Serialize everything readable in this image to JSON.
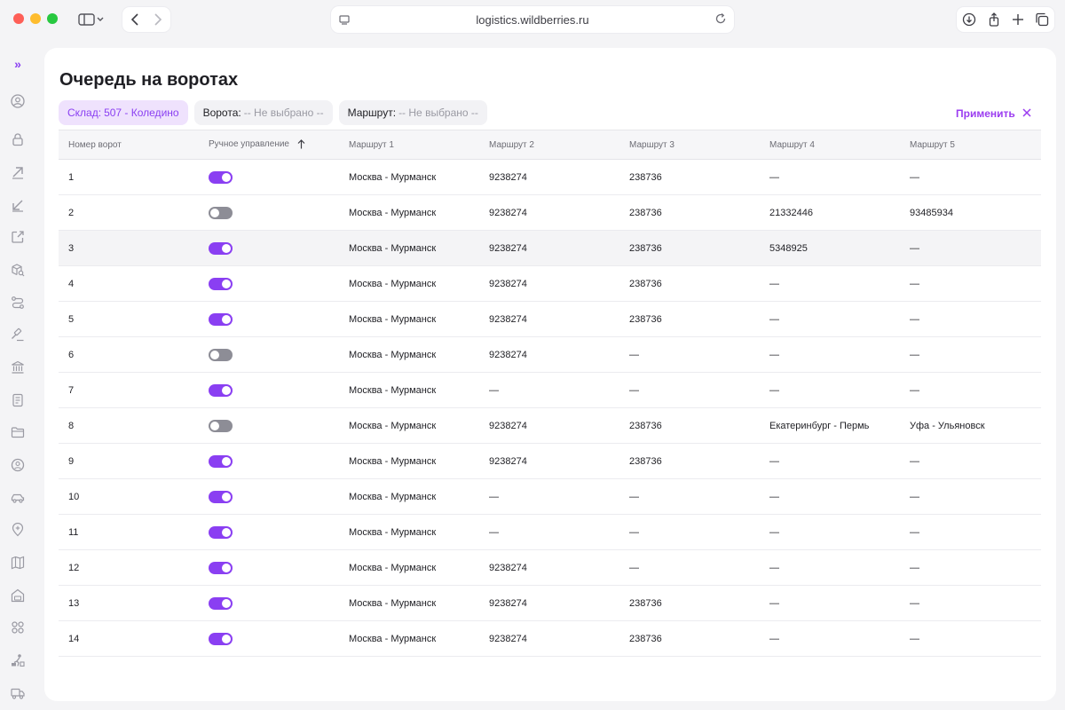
{
  "browser": {
    "url": "logistics.wildberries.ru"
  },
  "rail": {
    "items": [
      "expand-icon",
      "user-circle-icon",
      "lock-icon",
      "arrow-up-right-icon",
      "arrow-down-left-icon",
      "external-link-icon",
      "package-search-icon",
      "route-icon",
      "gavel-icon",
      "bank-icon",
      "document-icon",
      "folder-icon",
      "face-icon",
      "car-icon",
      "location-pin-icon",
      "map-icon",
      "warehouse-icon",
      "grid-icon",
      "worker-icon",
      "truck-icon"
    ]
  },
  "page": {
    "title": "Очередь на воротах"
  },
  "filters": {
    "warehouse": {
      "label": "Склад:",
      "value": "507 - Коледино"
    },
    "gates": {
      "label": "Ворота:",
      "value": "-- Не выбрано --"
    },
    "route": {
      "label": "Маршрут:",
      "value": "-- Не выбрано --"
    },
    "apply_label": "Применить"
  },
  "table": {
    "columns": [
      "Номер ворот",
      "Ручное управление",
      "Маршрут 1",
      "Маршрут 2",
      "Маршрут 3",
      "Маршрут 4",
      "Маршрут 5"
    ],
    "rows": [
      {
        "gate": "1",
        "manual": true,
        "r1": "Москва - Мурманск",
        "r2": "9238274",
        "r3": "238736",
        "r4": "—",
        "r5": "—"
      },
      {
        "gate": "2",
        "manual": false,
        "r1": "Москва - Мурманск",
        "r2": "9238274",
        "r3": "238736",
        "r4": "21332446",
        "r5": "93485934"
      },
      {
        "gate": "3",
        "manual": true,
        "r1": "Москва - Мурманск",
        "r2": "9238274",
        "r3": "238736",
        "r4": "5348925",
        "r5": "—"
      },
      {
        "gate": "4",
        "manual": true,
        "r1": "Москва - Мурманск",
        "r2": "9238274",
        "r3": "238736",
        "r4": "—",
        "r5": "—"
      },
      {
        "gate": "5",
        "manual": true,
        "r1": "Москва - Мурманск",
        "r2": "9238274",
        "r3": "238736",
        "r4": "—",
        "r5": "—"
      },
      {
        "gate": "6",
        "manual": false,
        "r1": "Москва - Мурманск",
        "r2": "9238274",
        "r3": "—",
        "r4": "—",
        "r5": "—"
      },
      {
        "gate": "7",
        "manual": true,
        "r1": "Москва - Мурманск",
        "r2": "—",
        "r3": "—",
        "r4": "—",
        "r5": "—"
      },
      {
        "gate": "8",
        "manual": false,
        "r1": "Москва - Мурманск",
        "r2": "9238274",
        "r3": "238736",
        "r4": "Екатеринбург - Пермь",
        "r5": "Уфа - Ульяновск"
      },
      {
        "gate": "9",
        "manual": true,
        "r1": "Москва - Мурманск",
        "r2": "9238274",
        "r3": "238736",
        "r4": "—",
        "r5": "—"
      },
      {
        "gate": "10",
        "manual": true,
        "r1": "Москва - Мурманск",
        "r2": "—",
        "r3": "—",
        "r4": "—",
        "r5": "—"
      },
      {
        "gate": "11",
        "manual": true,
        "r1": "Москва - Мурманск",
        "r2": "—",
        "r3": "—",
        "r4": "—",
        "r5": "—"
      },
      {
        "gate": "12",
        "manual": true,
        "r1": "Москва - Мурманск",
        "r2": "9238274",
        "r3": "—",
        "r4": "—",
        "r5": "—"
      },
      {
        "gate": "13",
        "manual": true,
        "r1": "Москва - Мурманск",
        "r2": "9238274",
        "r3": "238736",
        "r4": "—",
        "r5": "—"
      },
      {
        "gate": "14",
        "manual": true,
        "r1": "Москва - Мурманск",
        "r2": "9238274",
        "r3": "238736",
        "r4": "—",
        "r5": "—"
      }
    ]
  },
  "colors": {
    "accent": "#8a3ff2",
    "toggle_off": "#8d8d96"
  }
}
